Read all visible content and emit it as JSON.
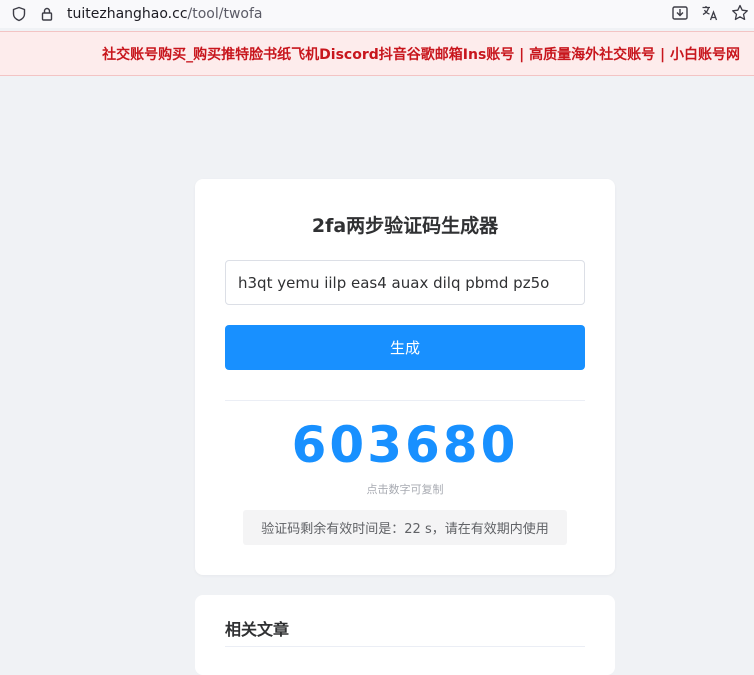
{
  "browser": {
    "url_host": "tuitezhanghao.cc",
    "url_path": "/tool/twofa"
  },
  "banner": {
    "text": "社交账号购买_购买推特脸书纸飞机Discord抖音谷歌邮箱Ins账号 | 高质量海外社交账号 | 小白账号网",
    "color": "#c8161d"
  },
  "tool": {
    "title": "2fa两步验证码生成器",
    "secret_value": "h3qt yemu iilp eas4 auax dilq pbmd pz5o",
    "generate_label": "生成",
    "code": "603680",
    "copy_hint": "点击数字可复制",
    "timer_text": "验证码剩余有效时间是：22 s，请在有效期内使用",
    "accent_color": "#1890ff"
  },
  "related": {
    "title": "相关文章"
  },
  "icons": {
    "shield": "shield-icon",
    "lock": "lock-icon",
    "download": "download-icon",
    "translate": "translate-icon",
    "bookmark": "star-icon"
  }
}
